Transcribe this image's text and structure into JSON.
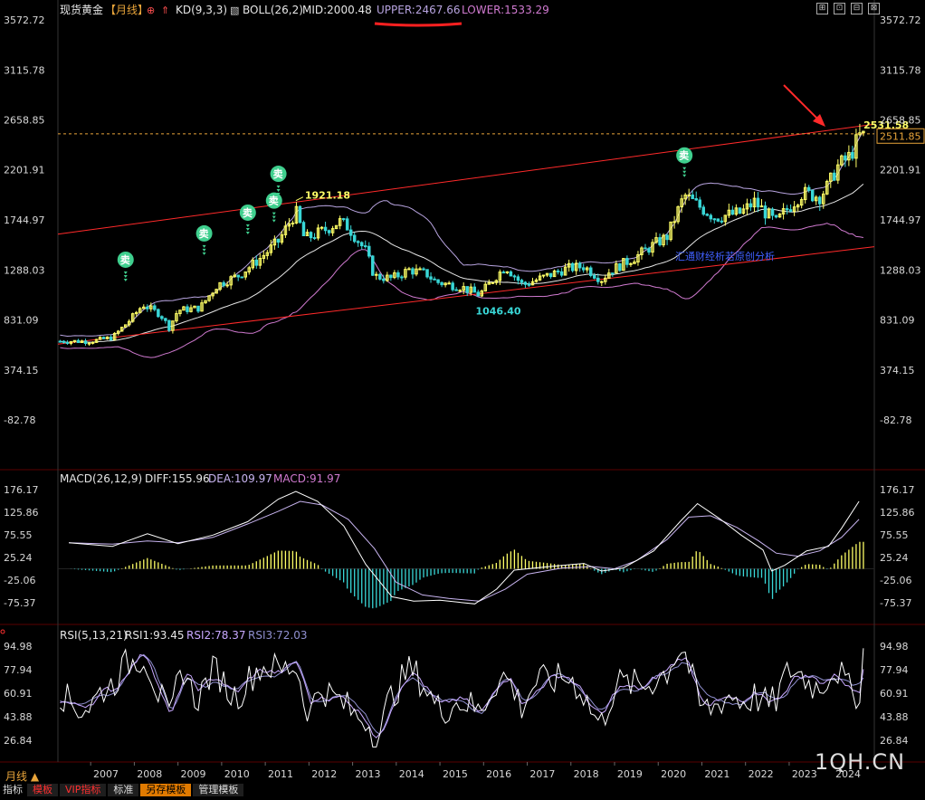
{
  "header": {
    "instrument": "现货黄金",
    "period_tag": "【月线】",
    "kd_label": "KD(9,3,3)",
    "boll_label": "BOLL(26,2)",
    "mid": "MID:2000.48",
    "upper": "UPPER:2467.66",
    "lower": "LOWER:1533.29"
  },
  "price_axis": [
    "3572.72",
    "3115.78",
    "2658.85",
    "2201.91",
    "1744.97",
    "1288.03",
    "831.09",
    "374.15",
    "-82.78"
  ],
  "macd_axis": [
    "176.17",
    "125.86",
    "75.55",
    "25.24",
    "-25.06",
    "-75.37"
  ],
  "rsi_axis": [
    "94.98",
    "77.94",
    "60.91",
    "43.88",
    "26.84"
  ],
  "macd_header": {
    "title": "MACD(26,12,9)",
    "diff": "DIFF:155.96",
    "dea": "DEA:109.97",
    "macd": "MACD:91.97"
  },
  "rsi_header": {
    "title": "RSI(5,13,21)",
    "rsi1": "RSI1:93.45",
    "rsi2": "RSI2:78.37",
    "rsi3": "RSI3:72.03"
  },
  "annotations": {
    "high_label": "1921.18",
    "low_label": "1046.40",
    "current_label": "2531.58",
    "current_box": "2511.85",
    "sell_glyph": "卖",
    "analysis_text": "汇通财经析若原创分析"
  },
  "years": [
    "2007",
    "2008",
    "2009",
    "2010",
    "2011",
    "2012",
    "2013",
    "2014",
    "2015",
    "2016",
    "2017",
    "2018",
    "2019",
    "2020",
    "2021",
    "2022",
    "2023",
    "2024"
  ],
  "period_label": "月线 ▲",
  "watermark": "1QH.CN",
  "window_icons": [
    "⊞",
    "⊡",
    "⊟",
    "⊠"
  ],
  "toolbar": {
    "items": [
      "指标",
      "模板",
      "VIP指标",
      "标准",
      "另存模板",
      "管理模板"
    ]
  },
  "colors": {
    "up": "#ffff66",
    "down": "#39d7d7",
    "boll_upper": "#b8a4e0",
    "boll_mid": "#e6e6e6",
    "trend": "#ff2a2a",
    "diff": "#ffffff",
    "dea": "#c8b4f0",
    "rsi1": "#ffffff",
    "rsi2": "#c8a8ff",
    "rsi3": "#9090d0",
    "sell": "#3fcf8e",
    "accent": "#ff2a2a"
  },
  "chart_data": [
    {
      "type": "candlestick",
      "title": "现货黄金 月线",
      "y_range": [
        -82.78,
        3572.72
      ],
      "x": [
        "2007",
        "2008",
        "2009",
        "2010",
        "2011",
        "2012",
        "2013",
        "2014",
        "2015",
        "2016",
        "2017",
        "2018",
        "2019",
        "2020",
        "2021",
        "2022",
        "2023",
        "2024"
      ],
      "close_approx": [
        [
          2007.0,
          636
        ],
        [
          2007.5,
          670
        ],
        [
          2007.9,
          830
        ],
        [
          2008.2,
          970
        ],
        [
          2008.6,
          880
        ],
        [
          2008.8,
          760
        ],
        [
          2009.0,
          920
        ],
        [
          2009.5,
          940
        ],
        [
          2009.9,
          1150
        ],
        [
          2010.4,
          1240
        ],
        [
          2010.9,
          1400
        ],
        [
          2011.3,
          1550
        ],
        [
          2011.7,
          1820
        ],
        [
          2011.9,
          1570
        ],
        [
          2012.3,
          1640
        ],
        [
          2012.7,
          1730
        ],
        [
          2012.9,
          1680
        ],
        [
          2013.3,
          1460
        ],
        [
          2013.5,
          1230
        ],
        [
          2013.9,
          1210
        ],
        [
          2014.3,
          1290
        ],
        [
          2014.7,
          1250
        ],
        [
          2014.9,
          1180
        ],
        [
          2015.5,
          1130
        ],
        [
          2015.9,
          1060
        ],
        [
          2016.5,
          1320
        ],
        [
          2016.9,
          1150
        ],
        [
          2017.5,
          1240
        ],
        [
          2017.9,
          1300
        ],
        [
          2018.3,
          1320
        ],
        [
          2018.7,
          1200
        ],
        [
          2018.9,
          1280
        ],
        [
          2019.5,
          1410
        ],
        [
          2019.9,
          1520
        ],
        [
          2020.2,
          1590
        ],
        [
          2020.6,
          1970
        ],
        [
          2020.9,
          1880
        ],
        [
          2021.3,
          1770
        ],
        [
          2021.9,
          1810
        ],
        [
          2022.2,
          1910
        ],
        [
          2022.7,
          1720
        ],
        [
          2022.9,
          1820
        ],
        [
          2023.3,
          1990
        ],
        [
          2023.7,
          1960
        ],
        [
          2023.9,
          2060
        ],
        [
          2024.1,
          2230
        ],
        [
          2024.4,
          2330
        ],
        [
          2024.6,
          2510
        ]
      ],
      "boll": {
        "upper": "UPPER:2467.66",
        "mid": "MID:2000.48",
        "lower": "LOWER:1533.29"
      },
      "marks": {
        "high": 1921.18,
        "low": 1046.4,
        "current": 2531.58,
        "last": 2511.85
      }
    },
    {
      "type": "macd",
      "y_range": [
        -75.37,
        176.17
      ],
      "series": [
        {
          "name": "DIFF",
          "points": [
            [
              2006.5,
              58
            ],
            [
              2007.5,
              50
            ],
            [
              2008.3,
              78
            ],
            [
              2009.0,
              56
            ],
            [
              2009.8,
              75
            ],
            [
              2010.6,
              105
            ],
            [
              2011.3,
              155
            ],
            [
              2011.7,
              172
            ],
            [
              2012.2,
              150
            ],
            [
              2012.8,
              95
            ],
            [
              2013.3,
              10
            ],
            [
              2013.9,
              -62
            ],
            [
              2014.4,
              -72
            ],
            [
              2015.0,
              -70
            ],
            [
              2015.8,
              -78
            ],
            [
              2016.3,
              -45
            ],
            [
              2016.7,
              -3
            ],
            [
              2017.5,
              5
            ],
            [
              2018.3,
              12
            ],
            [
              2018.7,
              -5
            ],
            [
              2019.2,
              2
            ],
            [
              2019.9,
              40
            ],
            [
              2020.5,
              105
            ],
            [
              2020.9,
              145
            ],
            [
              2021.4,
              112
            ],
            [
              2021.9,
              75
            ],
            [
              2022.4,
              42
            ],
            [
              2022.6,
              -5
            ],
            [
              2022.9,
              8
            ],
            [
              2023.4,
              40
            ],
            [
              2023.9,
              50
            ],
            [
              2024.2,
              90
            ],
            [
              2024.6,
              150
            ]
          ]
        },
        {
          "name": "DEA",
          "points": [
            [
              2006.5,
              58
            ],
            [
              2007.5,
              55
            ],
            [
              2008.3,
              62
            ],
            [
              2009.0,
              58
            ],
            [
              2009.8,
              70
            ],
            [
              2010.6,
              100
            ],
            [
              2011.3,
              128
            ],
            [
              2011.8,
              150
            ],
            [
              2012.3,
              142
            ],
            [
              2012.9,
              110
            ],
            [
              2013.5,
              45
            ],
            [
              2014.0,
              -30
            ],
            [
              2014.6,
              -58
            ],
            [
              2015.2,
              -66
            ],
            [
              2015.9,
              -72
            ],
            [
              2016.5,
              -45
            ],
            [
              2017.0,
              -12
            ],
            [
              2017.8,
              2
            ],
            [
              2018.5,
              5
            ],
            [
              2019.0,
              0
            ],
            [
              2019.5,
              18
            ],
            [
              2020.2,
              65
            ],
            [
              2020.7,
              115
            ],
            [
              2021.2,
              118
            ],
            [
              2021.8,
              92
            ],
            [
              2022.3,
              62
            ],
            [
              2022.7,
              35
            ],
            [
              2023.2,
              28
            ],
            [
              2023.7,
              40
            ],
            [
              2024.2,
              70
            ],
            [
              2024.6,
              110
            ]
          ]
        },
        {
          "name": "MACD",
          "note": "histogram = 2*(DIFF-DEA)"
        }
      ]
    },
    {
      "type": "rsi",
      "y_range": [
        26.84,
        94.98
      ],
      "series": [
        {
          "name": "RSI1",
          "last": 93.45
        },
        {
          "name": "RSI2",
          "last": 78.37
        },
        {
          "name": "RSI3",
          "last": 72.03
        }
      ]
    }
  ]
}
